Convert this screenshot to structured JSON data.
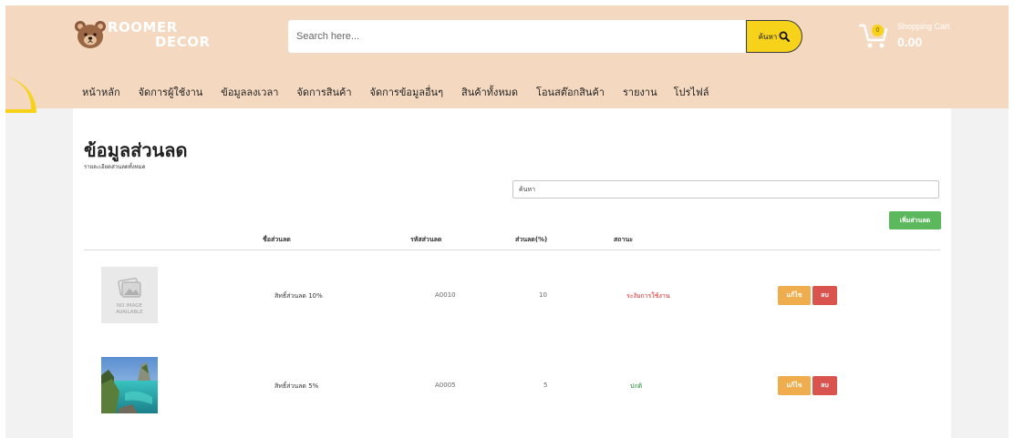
{
  "brand": {
    "line1": "ROOMER",
    "line2": "DECOR",
    "logo_icon": "bear-icon"
  },
  "search": {
    "placeholder": "Search here...",
    "button_label": "ค้นหา",
    "button_icon": "search-icon"
  },
  "cart": {
    "label": "Shopping Cart",
    "amount": "0.00",
    "count": "0",
    "icon": "shopping-cart-icon"
  },
  "nav": {
    "items": [
      {
        "label": "หน้าหลัก"
      },
      {
        "label": "จัดการผู้ใช้งาน"
      },
      {
        "label": "ข้อมูลลงเวลา"
      },
      {
        "label": "จัดการสินค้า"
      },
      {
        "label": "จัดการข้อมูลอื่นๆ"
      },
      {
        "label": "สินค้าทั้งหมด"
      },
      {
        "label": "โอนสต๊อกสินค้า"
      },
      {
        "label": "รายงาน"
      },
      {
        "label": "โปรไฟล์"
      }
    ]
  },
  "page": {
    "title": "ข้อมูลส่วนลด",
    "subtitle": "รายละเอียดส่วนลดทั้งหมด"
  },
  "filter": {
    "placeholder": "ค้นหา"
  },
  "add_button": {
    "label": "เพิ่มส่วนลด"
  },
  "table": {
    "headers": {
      "name": "ชื่อส่วนลด",
      "code": "รหัสส่วนลด",
      "discount": "ส่วนลด(%)",
      "status": "สถานะ"
    },
    "rows": [
      {
        "image_text": "NO IMAGE AVAILABLE",
        "image_line1": "NO IMAGE",
        "image_line2": "AVAILABLE",
        "name": "สิทธิ์ส่วนลด 10%",
        "code": "A0010",
        "discount": "10",
        "status": "ระงับการใช้งาน",
        "status_color": "#e02020",
        "edit_label": "แก้ไข",
        "delete_label": "ลบ"
      },
      {
        "image_text": "",
        "name": "สิทธิ์ส่วนลด 5%",
        "code": "A0005",
        "discount": "5",
        "status": "ปกติ",
        "status_color": "#1d8a2a",
        "edit_label": "แก้ไข",
        "delete_label": "ลบ"
      }
    ]
  },
  "colors": {
    "header_bg": "#f4d8bf",
    "accent_yellow": "#f7d21a",
    "add_green": "#5cb85c",
    "edit_orange": "#f0ad4e",
    "delete_red": "#d9534f"
  }
}
